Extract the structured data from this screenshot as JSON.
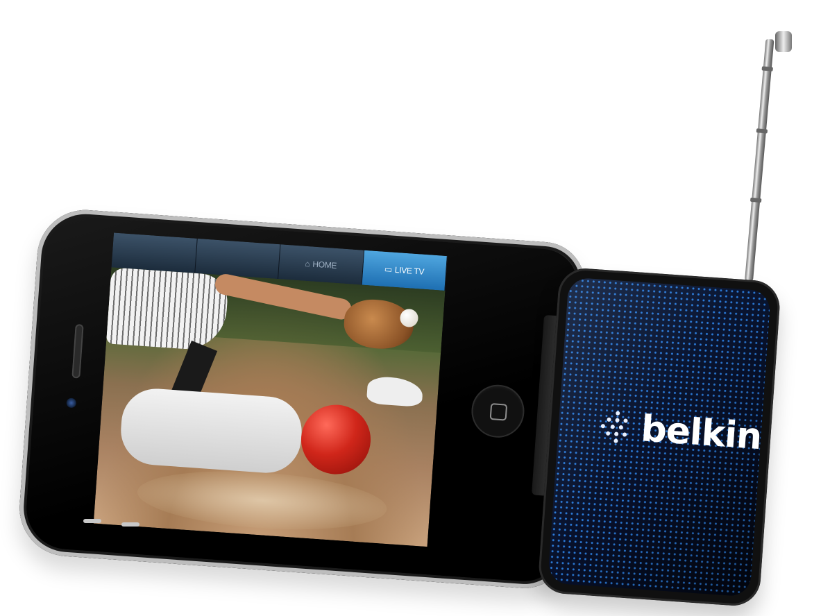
{
  "screen": {
    "tabs": [
      {
        "label": "",
        "icon": "",
        "active": false
      },
      {
        "label": "",
        "icon": "",
        "active": false
      },
      {
        "label": "HOME",
        "icon": "home-icon",
        "active": false
      },
      {
        "label": "LIVE TV",
        "icon": "tv-icon",
        "active": true
      }
    ]
  },
  "tuner": {
    "brand": "belkin"
  },
  "colors": {
    "tab_active": "#2a86cc",
    "tab_bar": "#2b3f53",
    "helmet_red": "#d0261a",
    "tuner_blue": "#2b7ad8"
  }
}
